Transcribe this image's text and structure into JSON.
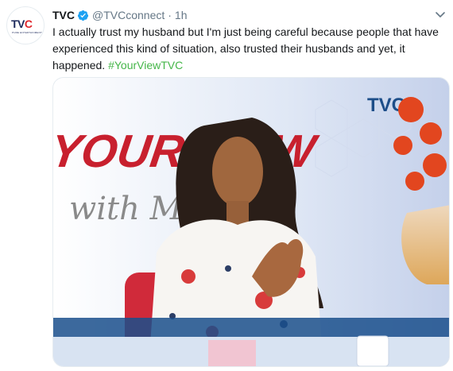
{
  "tweet": {
    "author_name": "TVC",
    "handle": "@TVCconnect",
    "separator": "·",
    "time": "1h",
    "text": "I actually trust my husband but I'm just being careful because people that have experienced this kind of situation, also trusted their husbands and yet, it happened.",
    "hashtag": "#YourViewTVC",
    "verified_icon": "verified-badge-icon",
    "menu_icon": "chevron-down-icon"
  },
  "avatar": {
    "logo_text_tv": "TV",
    "logo_text_c": "C",
    "logo_subtext": "PURE ENTERTAINMENT"
  },
  "media": {
    "show_title": "YOUR VIEW",
    "show_script": "with Mo",
    "channel_logo": "TVC"
  },
  "colors": {
    "hashtag": "#45b649",
    "verified": "#1da1f2",
    "secondary_text": "#657786",
    "brand_red": "#e0252b",
    "brand_navy": "#1d2a5c"
  }
}
